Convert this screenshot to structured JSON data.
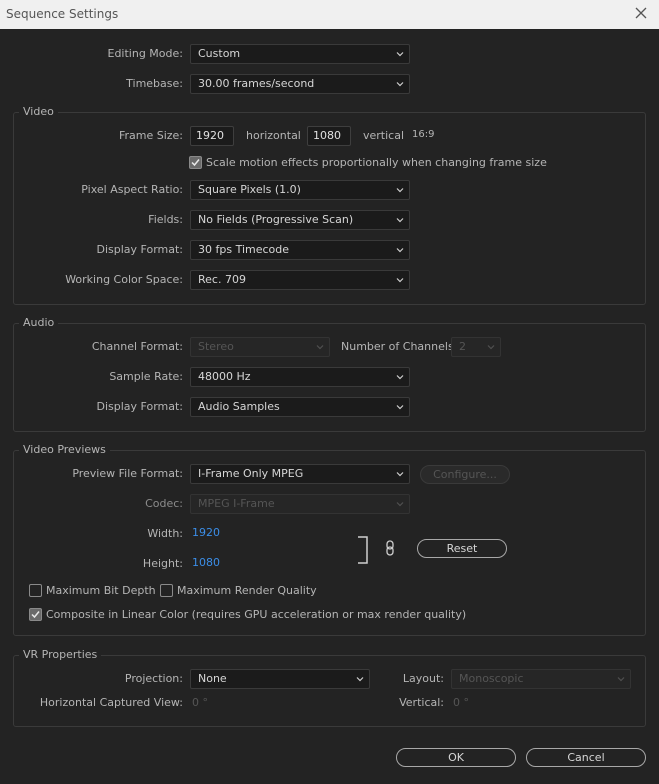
{
  "window": {
    "title": "Sequence Settings"
  },
  "general": {
    "editing_mode_label": "Editing Mode:",
    "editing_mode_value": "Custom",
    "timebase_label": "Timebase:",
    "timebase_value": "30.00  frames/second"
  },
  "video": {
    "title": "Video",
    "frame_size_label": "Frame Size:",
    "frame_width": "1920",
    "horizontal_label": "horizontal",
    "frame_height": "1080",
    "vertical_label": "vertical",
    "aspect": "16:9",
    "scale_motion_label": "Scale motion effects proportionally when changing frame size",
    "scale_motion_checked": true,
    "pixel_aspect_label": "Pixel Aspect Ratio:",
    "pixel_aspect_value": "Square Pixels (1.0)",
    "fields_label": "Fields:",
    "fields_value": "No Fields (Progressive Scan)",
    "display_format_label": "Display Format:",
    "display_format_value": "30 fps Timecode",
    "color_space_label": "Working Color Space:",
    "color_space_value": "Rec. 709"
  },
  "audio": {
    "title": "Audio",
    "channel_format_label": "Channel Format:",
    "channel_format_value": "Stereo",
    "num_channels_label": "Number of Channels:",
    "num_channels_value": "2",
    "sample_rate_label": "Sample Rate:",
    "sample_rate_value": "48000 Hz",
    "display_format_label": "Display Format:",
    "display_format_value": "Audio Samples"
  },
  "previews": {
    "title": "Video Previews",
    "file_format_label": "Preview File Format:",
    "file_format_value": "I-Frame Only MPEG",
    "configure_label": "Configure...",
    "codec_label": "Codec:",
    "codec_value": "MPEG I-Frame",
    "width_label": "Width:",
    "width_value": "1920",
    "height_label": "Height:",
    "height_value": "1080",
    "reset_label": "Reset",
    "max_bit_depth_label": "Maximum Bit Depth",
    "max_bit_depth_checked": false,
    "max_render_quality_label": "Maximum Render Quality",
    "max_render_quality_checked": false,
    "composite_linear_label": "Composite in Linear Color (requires GPU acceleration or max render quality)",
    "composite_linear_checked": true
  },
  "vr": {
    "title": "VR Properties",
    "projection_label": "Projection:",
    "projection_value": "None",
    "layout_label": "Layout:",
    "layout_value": "Monoscopic",
    "h_captured_label": "Horizontal Captured View:",
    "h_captured_value": "0 °",
    "vertical_label": "Vertical:",
    "vertical_value": "0 °"
  },
  "footer": {
    "ok_label": "OK",
    "cancel_label": "Cancel"
  },
  "colors": {
    "background": "#232323",
    "link": "#3b8ee8",
    "titlebar": "#f0f0f0"
  }
}
